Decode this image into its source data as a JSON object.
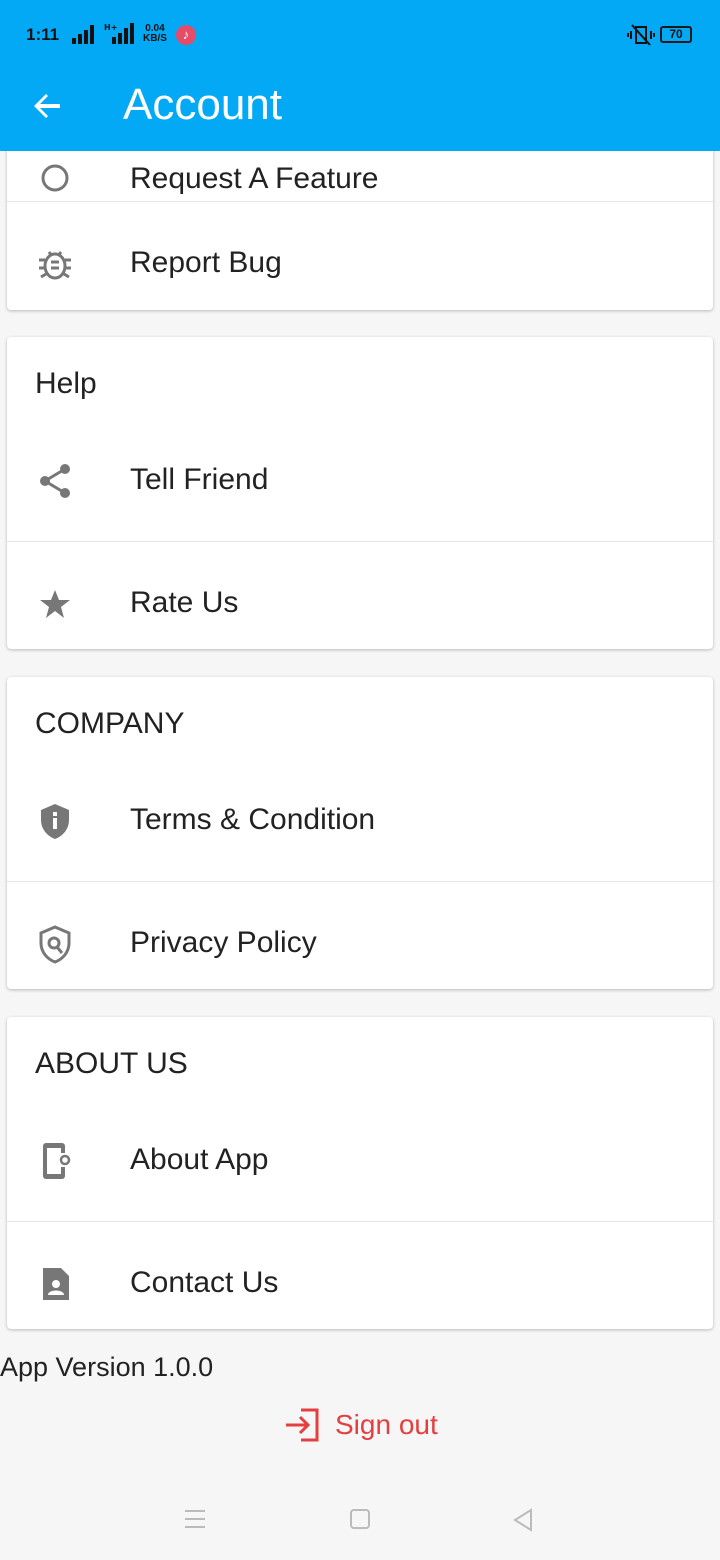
{
  "status_bar": {
    "time": "1:11",
    "speed_value": "0.04",
    "speed_unit": "KB/S",
    "battery": "70"
  },
  "header": {
    "title": "Account",
    "back_icon": "arrow-left-icon"
  },
  "feedback_section": {
    "items": [
      {
        "label": "Request A Feature",
        "icon": "lightbulb-icon"
      },
      {
        "label": "Report Bug",
        "icon": "bug-icon"
      }
    ]
  },
  "help_section": {
    "title": "Help",
    "items": [
      {
        "label": "Tell Friend",
        "icon": "share-icon"
      },
      {
        "label": "Rate Us",
        "icon": "star-icon"
      }
    ]
  },
  "company_section": {
    "title": "COMPANY",
    "items": [
      {
        "label": "Terms & Condition",
        "icon": "shield-info-icon"
      },
      {
        "label": "Privacy Policy",
        "icon": "shield-search-icon"
      }
    ]
  },
  "about_section": {
    "title": "ABOUT US",
    "items": [
      {
        "label": "About App",
        "icon": "phone-settings-icon"
      },
      {
        "label": "Contact Us",
        "icon": "contact-card-icon"
      }
    ]
  },
  "footer": {
    "version_text": "App Version 1.0.0",
    "signout_label": "Sign out",
    "signout_icon": "sign-in-icon"
  },
  "colors": {
    "appbar": "#03a9f4",
    "signout": "#e53e3e",
    "icon_gray": "#777777"
  }
}
